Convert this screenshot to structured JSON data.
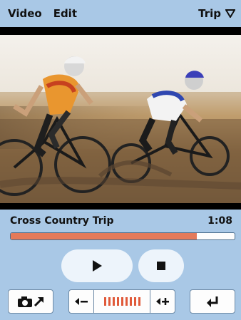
{
  "menu": {
    "video": "Video",
    "edit": "Edit",
    "trip": "Trip"
  },
  "track": {
    "title": "Cross Country Trip",
    "time": "1:08",
    "progress": 0.83
  },
  "icons": {
    "play": "play-icon",
    "stop": "stop-icon",
    "camera": "camera-export-icon",
    "volume_down": "volume-down-icon",
    "volume_up": "volume-up-icon",
    "back": "return-icon",
    "dropdown": "triangle-down-icon"
  },
  "volume": {
    "ticks": 9,
    "level": 9
  },
  "colors": {
    "background": "#a9c8e6",
    "accent": "#e05a3a",
    "button": "#edf4fb"
  }
}
